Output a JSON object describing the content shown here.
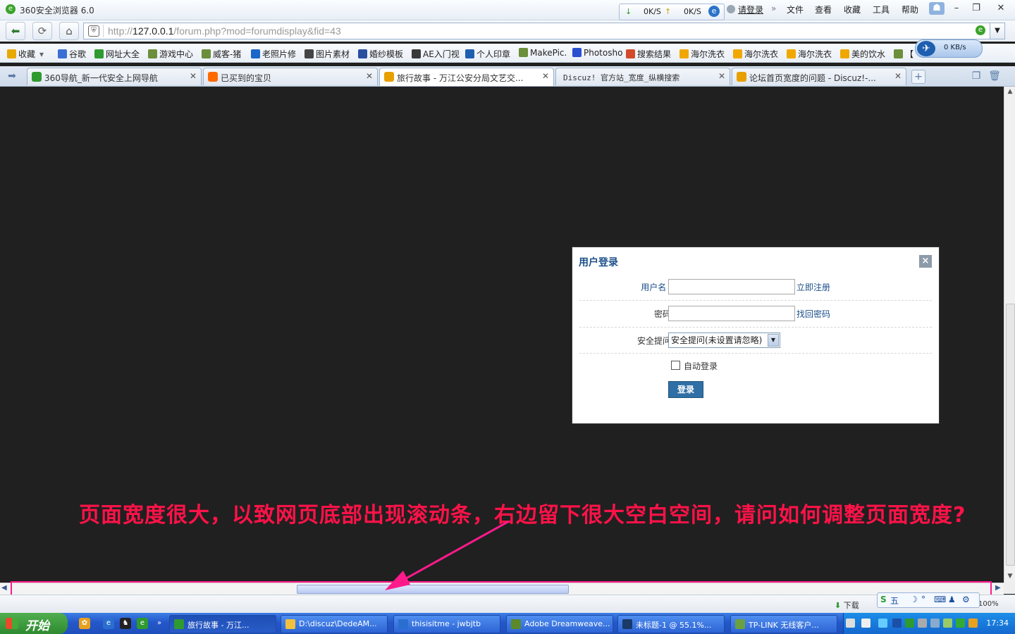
{
  "window": {
    "title": "360安全浏览器 6.0"
  },
  "speed": {
    "down": "0K/S",
    "up": "0K/S"
  },
  "login_link": "请登录",
  "menu": [
    "文件",
    "查看",
    "收藏",
    "工具",
    "帮助"
  ],
  "address": {
    "scheme": "http://",
    "host": "127.0.0.1",
    "path": "/forum.php?mod=forumdisplay&fid=43"
  },
  "bookmarks": [
    {
      "label": "收藏",
      "icon": "star-icon",
      "color": "#e8a900"
    },
    {
      "label": "谷歌",
      "icon": "google-icon",
      "color": "#3b6fd6"
    },
    {
      "label": "网址大全",
      "icon": "360-icon",
      "color": "#2f9a2f"
    },
    {
      "label": "游戏中心",
      "icon": "page-icon",
      "color": "#6b8f3a"
    },
    {
      "label": "威客-猪",
      "icon": "page-icon",
      "color": "#6b8f3a"
    },
    {
      "label": "老照片修",
      "icon": "youku-icon",
      "color": "#1b66c9"
    },
    {
      "label": "图片素材",
      "icon": "nipic-icon",
      "color": "#444444"
    },
    {
      "label": "婚纱模板",
      "icon": "template-icon",
      "color": "#2a4fa0"
    },
    {
      "label": "AE入门视",
      "icon": "ae-icon",
      "color": "#3a3a3a"
    },
    {
      "label": "个人印章",
      "icon": "stamp-icon",
      "color": "#1f5fb0"
    },
    {
      "label": "MakePic.",
      "icon": "page-icon",
      "color": "#6b8f3a"
    },
    {
      "label": "Photosho",
      "icon": "baidu-icon",
      "color": "#2a4fd0"
    },
    {
      "label": "搜索结果",
      "icon": "search-result-icon",
      "color": "#d24a2a"
    },
    {
      "label": "海尔洗衣",
      "icon": "ie-icon",
      "color": "#f0a800"
    },
    {
      "label": "海尔洗衣",
      "icon": "ie-icon",
      "color": "#f0a800"
    },
    {
      "label": "海尔洗衣",
      "icon": "ie-icon",
      "color": "#f0a800"
    },
    {
      "label": "美的饮水",
      "icon": "ie-icon",
      "color": "#f0a800"
    },
    {
      "label": "【",
      "icon": "page-icon",
      "color": "#6b8f3a"
    }
  ],
  "float_speed": "0 KB/s",
  "tabs": [
    {
      "label": "360导航_新一代安全上网导航",
      "icon": "360-icon",
      "color": "#2f9a2f",
      "active": false
    },
    {
      "label": "已买到的宝贝",
      "icon": "taobao-icon",
      "color": "#ff6a00",
      "active": false
    },
    {
      "label": "旅行故事 - 万江公安分局文艺交...",
      "icon": "discuz-icon",
      "color": "#e8a000",
      "active": true
    },
    {
      "label": "Discuz! 官方站_宽度_纵横搜索",
      "icon": "",
      "color": "#ffffff",
      "active": false
    },
    {
      "label": "论坛首页宽度的问题 - Discuz!-...",
      "icon": "discuz-icon",
      "color": "#e8a000",
      "active": false
    }
  ],
  "login_dialog": {
    "title": "用户登录",
    "username_label": "用户名",
    "register_link": "立即注册",
    "password_label": "密码:",
    "forgot_link": "找回密码",
    "question_label": "安全提问:",
    "question_value": "安全提问(未设置请忽略)",
    "autologin_label": "自动登录",
    "submit_label": "登录"
  },
  "annotation": "页面宽度很大，以致网页底部出现滚动条，右边留下很大空白空间，请问如何调整页面宽度?",
  "status": {
    "download_label": "下载",
    "zoom": "100%",
    "ime": "五"
  },
  "taskbar": {
    "start_label": "开始",
    "tasks": [
      {
        "label": "旅行故事 - 万江...",
        "icon": "360-icon",
        "color": "#2f9a2f",
        "active": true
      },
      {
        "label": "D:\\discuz\\DedeAM...",
        "icon": "folder-icon",
        "color": "#f0c040",
        "active": false
      },
      {
        "label": "thisisitme - jwbjtb",
        "icon": "globe-icon",
        "color": "#2a6fd0",
        "active": false
      },
      {
        "label": "Adobe Dreamweave...",
        "icon": "dreamweaver-icon",
        "color": "#5a8a2a",
        "active": false
      },
      {
        "label": "未标题-1 @ 55.1%...",
        "icon": "photoshop-icon",
        "color": "#1a3a6a",
        "active": false
      },
      {
        "label": "TP-LINK 无线客户...",
        "icon": "tplink-icon",
        "color": "#6aa040",
        "active": false
      }
    ],
    "clock": "17:34"
  },
  "colors": {
    "annotation": "#ff1248",
    "annotation_box": "#ff1a8c",
    "dialog_title": "#1c4f8a",
    "page_bg": "#202020"
  }
}
